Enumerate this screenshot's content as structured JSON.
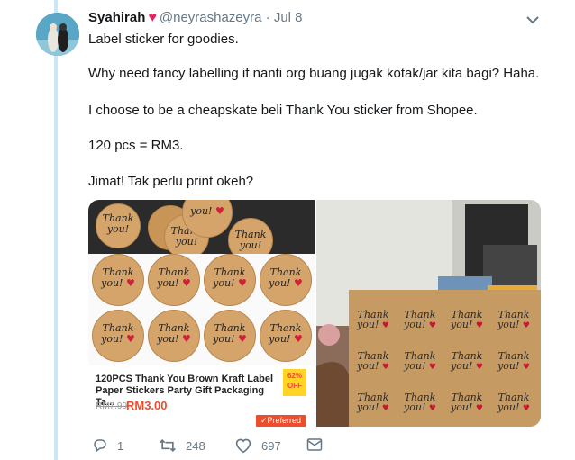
{
  "tweet": {
    "author_name": "Syahirah",
    "author_badge": "♥",
    "handle": "@neyrashazeyra",
    "separator": "·",
    "date": "Jul 8",
    "lines": [
      "Label sticker for goodies.",
      "Why need fancy labelling if nanti org buang jugak kotak/jar kita bagi? Haha.",
      "I choose to be a cheapskate beli Thank You sticker from Shopee.",
      "120 pcs = RM3.",
      "Jimat! Tak perlu print okeh?"
    ]
  },
  "shop_listing": {
    "title": "120PCS Thank You Brown Kraft Label Paper Stickers Party Gift Packaging Ta...",
    "old_price": "RM7.99",
    "new_price": "RM3.00",
    "discount_percent": "62%",
    "discount_label": "OFF",
    "preferred_label": "✓Preferred",
    "sticker_text_1": "Thank",
    "sticker_text_2": "you!"
  },
  "actions": {
    "reply_count": "1",
    "retweet_count": "248",
    "like_count": "697"
  },
  "colors": {
    "thread_line": "#cce6f7",
    "heart": "#e0245e",
    "price": "#ee4d2d"
  },
  "icons": [
    "heart-icon",
    "chevron-down-icon",
    "reply-icon",
    "retweet-icon",
    "like-icon",
    "message-icon"
  ]
}
